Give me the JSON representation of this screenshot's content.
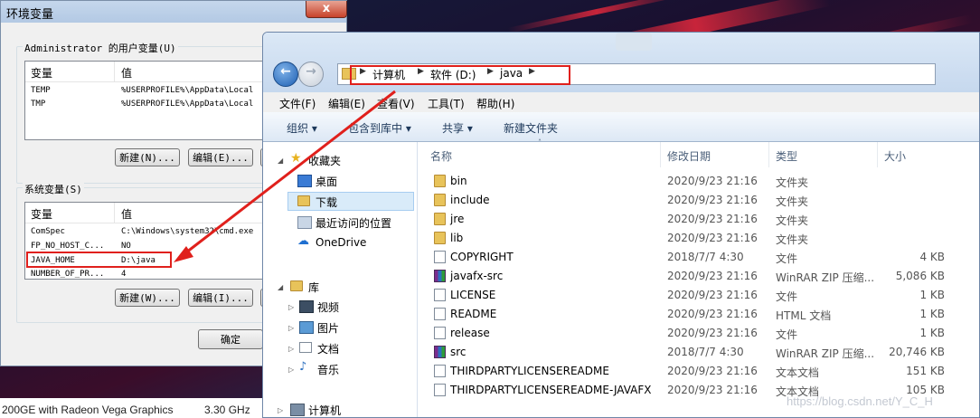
{
  "desktop": {
    "sysinfo_gpu": "200GE with Radeon Vega Graphics",
    "sysinfo_freq": "3.30 GHz"
  },
  "env_dialog": {
    "title": "环境变量",
    "close_label": "x",
    "user_group_label": "Administrator 的用户变量(U)",
    "user_vars_header": {
      "name": "变量",
      "value": "值"
    },
    "user_vars": [
      {
        "name": "TEMP",
        "value": "%USERPROFILE%\\AppData\\Local"
      },
      {
        "name": "TMP",
        "value": "%USERPROFILE%\\AppData\\Local"
      }
    ],
    "user_buttons": {
      "new": "新建(N)...",
      "edit": "编辑(E)..."
    },
    "system_group_label": "系统变量(S)",
    "system_vars_header": {
      "name": "变量",
      "value": "值"
    },
    "system_vars": [
      {
        "name": "ComSpec",
        "value": "C:\\Windows\\system32\\cmd.exe"
      },
      {
        "name": "FP_NO_HOST_C...",
        "value": "NO"
      },
      {
        "name": "JAVA_HOME",
        "value": "D:\\java"
      },
      {
        "name": "NUMBER_OF_PR...",
        "value": "4"
      }
    ],
    "system_buttons": {
      "new": "新建(W)...",
      "edit": "编辑(I)..."
    },
    "ok_label": "确定"
  },
  "explorer": {
    "breadcrumb": [
      "计算机",
      "软件 (D:)",
      "java"
    ],
    "menu": [
      "文件(F)",
      "编辑(E)",
      "查看(V)",
      "工具(T)",
      "帮助(H)"
    ],
    "toolbar": [
      "组织 ▾",
      "包含到库中 ▾",
      "共享 ▾",
      "新建文件夹"
    ],
    "nav": {
      "favorites": "收藏夹",
      "desktop": "桌面",
      "downloads": "下载",
      "recent": "最近访问的位置",
      "onedrive": "OneDrive",
      "libraries": "库",
      "videos": "视频",
      "pictures": "图片",
      "documents": "文档",
      "music": "音乐",
      "computer": "计算机"
    },
    "columns": {
      "name": "名称",
      "modified": "修改日期",
      "type": "类型",
      "size": "大小"
    },
    "files": [
      {
        "name": "bin",
        "modified": "2020/9/23 21:16",
        "type": "文件夹",
        "size": "",
        "icon": "folder-icon"
      },
      {
        "name": "include",
        "modified": "2020/9/23 21:16",
        "type": "文件夹",
        "size": "",
        "icon": "folder-icon"
      },
      {
        "name": "jre",
        "modified": "2020/9/23 21:16",
        "type": "文件夹",
        "size": "",
        "icon": "folder-icon"
      },
      {
        "name": "lib",
        "modified": "2020/9/23 21:16",
        "type": "文件夹",
        "size": "",
        "icon": "folder-icon"
      },
      {
        "name": "COPYRIGHT",
        "modified": "2018/7/7 4:30",
        "type": "文件",
        "size": "4 KB",
        "icon": "file-icon"
      },
      {
        "name": "javafx-src",
        "modified": "2020/9/23 21:16",
        "type": "WinRAR ZIP 压缩...",
        "size": "5,086 KB",
        "icon": "archive-icon"
      },
      {
        "name": "LICENSE",
        "modified": "2020/9/23 21:16",
        "type": "文件",
        "size": "1 KB",
        "icon": "file-icon"
      },
      {
        "name": "README",
        "modified": "2020/9/23 21:16",
        "type": "HTML 文档",
        "size": "1 KB",
        "icon": "file-icon"
      },
      {
        "name": "release",
        "modified": "2020/9/23 21:16",
        "type": "文件",
        "size": "1 KB",
        "icon": "file-icon"
      },
      {
        "name": "src",
        "modified": "2018/7/7 4:30",
        "type": "WinRAR ZIP 压缩...",
        "size": "20,746 KB",
        "icon": "archive-icon"
      },
      {
        "name": "THIRDPARTYLICENSEREADME",
        "modified": "2020/9/23 21:16",
        "type": "文本文档",
        "size": "151 KB",
        "icon": "file-icon"
      },
      {
        "name": "THIRDPARTYLICENSEREADME-JAVAFX",
        "modified": "2020/9/23 21:16",
        "type": "文本文档",
        "size": "105 KB",
        "icon": "file-icon"
      }
    ]
  },
  "watermark": "https://blog.csdn.net/Y_C_H",
  "colors": {
    "annotation_red": "#e0201c",
    "folder": "#e8c35a"
  }
}
